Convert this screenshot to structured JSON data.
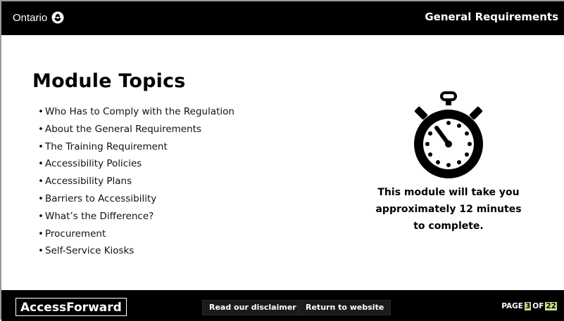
{
  "header": {
    "logo_text": "Ontario",
    "logo_icon": "trillium-icon",
    "title": "General Requirements"
  },
  "main": {
    "title": "Module Topics",
    "bullet": "•",
    "topics": [
      "Who Has to Comply with the Regulation",
      "About the General Requirements",
      "The Training Requirement",
      "Accessibility Policies",
      "Accessibility Plans",
      "Barriers to Accessibility",
      "What’s the Difference?",
      "Procurement",
      "Self-Service Kiosks"
    ],
    "timer_icon": "stopwatch-icon",
    "time_note": {
      "line1": "This module will take you",
      "line2": "approximately 12 minutes",
      "line3": "to complete."
    }
  },
  "footer": {
    "brand": "AccessForward",
    "disclaimer_label": "Read our disclaimer",
    "return_label": "Return to website",
    "page_prefix": "PAGE",
    "page_current": "3",
    "page_of": "OF",
    "page_total": "22"
  },
  "colors": {
    "bar_background": "#000000",
    "page_highlight": "#c9e08a"
  }
}
